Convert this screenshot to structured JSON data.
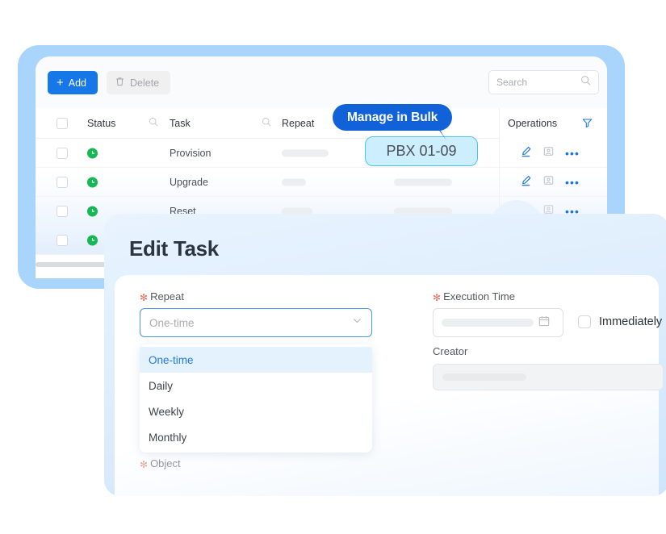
{
  "toolbar": {
    "add_label": "Add",
    "add_icon": "plus-icon",
    "delete_label": "Delete",
    "delete_icon": "trash-icon",
    "search_placeholder": "Search",
    "search_icon": "search-icon"
  },
  "table": {
    "columns": [
      {
        "key": "checkbox",
        "label": ""
      },
      {
        "key": "status",
        "label": "Status",
        "has_search": true
      },
      {
        "key": "task",
        "label": "Task",
        "has_search": true
      },
      {
        "key": "repeat",
        "label": "Repeat"
      },
      {
        "key": "object",
        "label": ""
      },
      {
        "key": "operations",
        "label": "Operations",
        "has_filter": true
      }
    ],
    "operations_header": "Operations",
    "filter_icon": "filter-icon",
    "rows": [
      {
        "status_icon": "clock-icon",
        "status_color": "#18b755",
        "task": "Provision",
        "repeat": "",
        "object": "",
        "repeat_width": 58,
        "object_width": 0
      },
      {
        "status_icon": "clock-icon",
        "status_color": "#18b755",
        "task": "Upgrade",
        "repeat": "",
        "object": "",
        "repeat_width": 30,
        "object_width": 72
      },
      {
        "status_icon": "clock-icon",
        "status_color": "#18b755",
        "task": "Reset",
        "repeat": "",
        "object": "",
        "repeat_width": 38,
        "object_width": 72
      },
      {
        "status_icon": "clock-icon",
        "status_color": "#18b755",
        "task": "",
        "repeat": "",
        "object": "",
        "repeat_width": 0,
        "object_width": 0
      }
    ],
    "row_operations": [
      {
        "edit_icon": "edit-pencil-icon",
        "archive_icon": "archive-icon",
        "more_icon": "more-dots-icon",
        "more_label": "•••"
      },
      {
        "edit_icon": "edit-pencil-icon",
        "archive_icon": "archive-icon",
        "more_icon": "more-dots-icon",
        "more_label": "•••"
      },
      {
        "edit_icon": "edit-pencil-icon",
        "archive_icon": "archive-icon",
        "more_icon": "more-dots-icon",
        "more_label": "•••"
      }
    ]
  },
  "callout": {
    "badge_label": "Manage in Bulk",
    "badge_color": "#1162d8",
    "pill_label": "PBX 01-09",
    "pill_bg": "#cdeefd",
    "pill_border": "#4fc3f7",
    "arrow_color": "#e8651a",
    "fab_icon": "edit-pencil-icon",
    "fab_bg": "#e9f3fe"
  },
  "modal": {
    "title": "Edit Task",
    "repeat": {
      "label": "Repeat",
      "required": true,
      "value": "One-time",
      "chevron_icon": "chevron-down-icon",
      "options": [
        "One-time",
        "Daily",
        "Weekly",
        "Monthly"
      ],
      "selected_index": 0
    },
    "execution_time": {
      "label": "Execution Time",
      "required": true,
      "value": "",
      "calendar_icon": "calendar-icon"
    },
    "immediately": {
      "label": "Immediately",
      "checked": false
    },
    "creator": {
      "label": "Creator",
      "required": false,
      "value": ""
    },
    "object": {
      "label": "Object",
      "required": true
    }
  }
}
